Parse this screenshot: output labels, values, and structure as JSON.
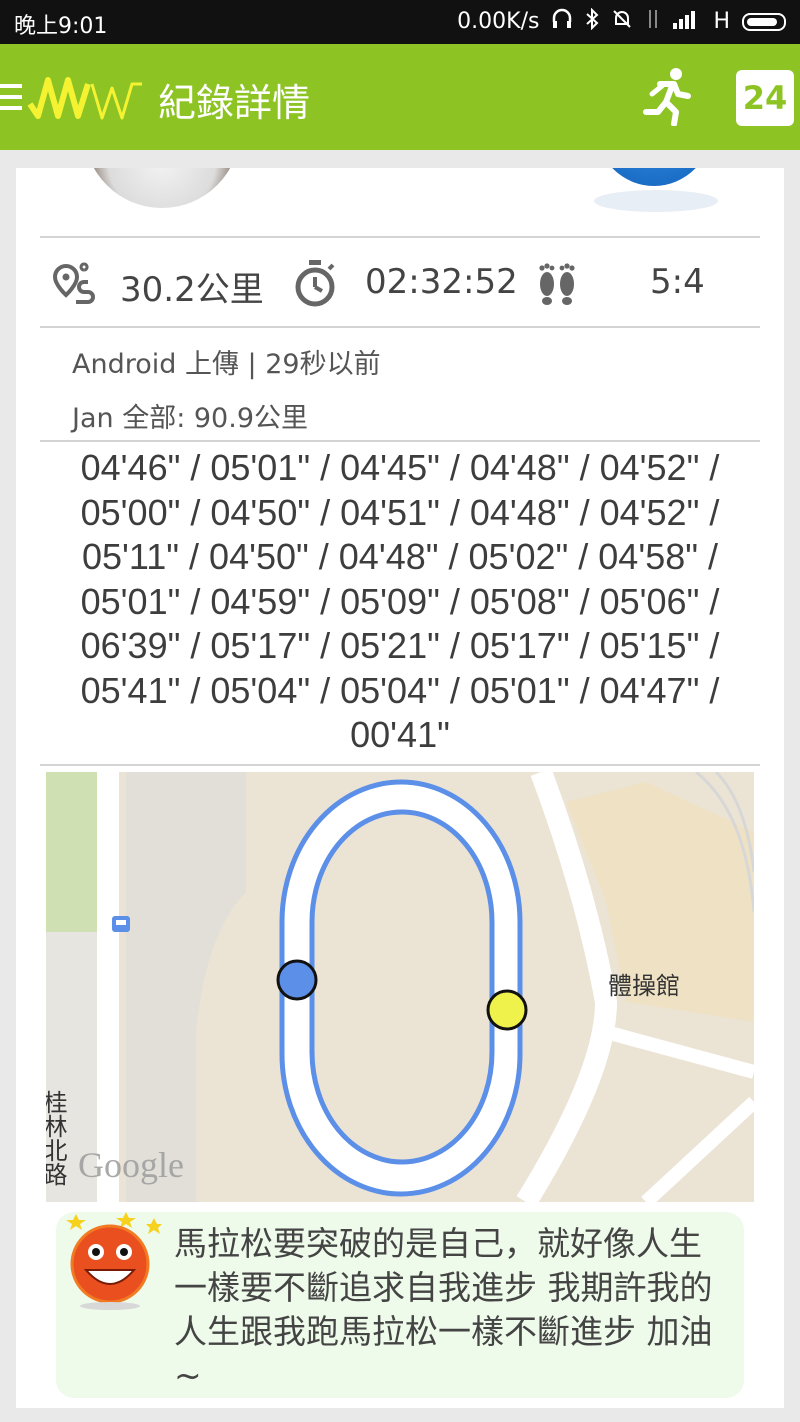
{
  "status_bar": {
    "time": "晚上9:01",
    "network_speed": "0.00K/s",
    "network_type": "H",
    "icons": [
      "headset-icon",
      "bluetooth-icon",
      "mute-icon",
      "data-icon",
      "signal-icon",
      "battery-icon"
    ]
  },
  "app_bar": {
    "logo_text": "MW",
    "title": "紀錄詳情",
    "date_badge": "24",
    "accent_color": "#8dc423"
  },
  "stats": {
    "distance": "30.2公里",
    "duration": "02:32:52",
    "steps": "5:4"
  },
  "meta": {
    "upload": "Android 上傳  |  29秒以前",
    "monthly_total": "Jan 全部:  90.9公里"
  },
  "splits": {
    "line1": "04'46\" / 05'01\" / 04'45\" / 04'48\" / 04'52\" /",
    "line2": "05'00\" / 04'50\" / 04'51\" / 04'48\" / 04'52\" /",
    "line3": "05'11\" / 04'50\" / 04'48\" / 05'02\" / 04'58\" /",
    "line4": "05'01\" / 04'59\" / 05'09\" / 05'08\" / 05'06\" /",
    "line5": "06'39\" / 05'17\" / 05'21\" / 05'17\" / 05'15\" /",
    "line6": "05'41\" / 05'04\" / 05'04\" / 05'01\" / 04'47\" /",
    "line7": "00'41\""
  },
  "map": {
    "gym_label": "體操館",
    "road_label": "桂林北路",
    "attribution": "Google",
    "start_color": "#5b8fe8",
    "end_color": "#eef24a",
    "route_color": "#5b8fe8"
  },
  "quote": {
    "text": "馬拉松要突破的是自己，就好像人生一樣要不斷追求自我進步 我期許我的人生跟我跑馬拉松一樣不斷進步 加油~"
  }
}
